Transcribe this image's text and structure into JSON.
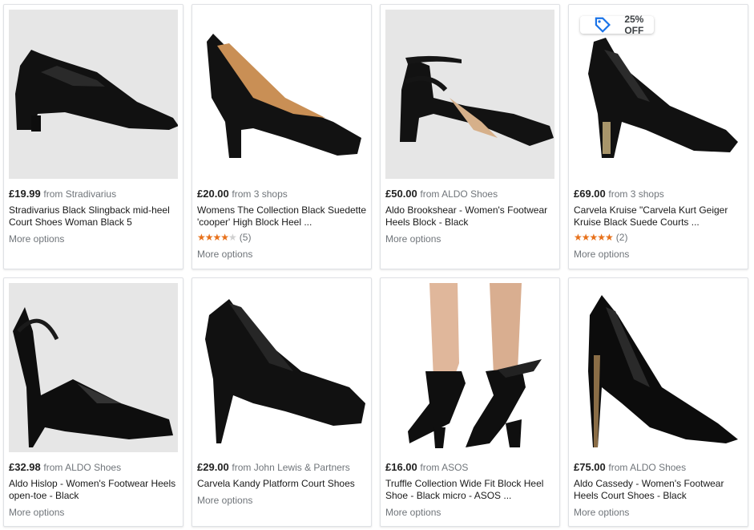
{
  "products": [
    {
      "price": "£19.99",
      "from": "from Stradivarius",
      "title": "Stradivarius Black Slingback mid-heel Court Shoes Woman Black 5",
      "more": "More options",
      "shoe_icon": "slingback-block-heel-image"
    },
    {
      "price": "£20.00",
      "from": "from 3 shops",
      "title": "Womens The Collection Black Suedette 'cooper' High Block Heel ...",
      "rating": {
        "stars": 4,
        "count": "(5)"
      },
      "more": "More options",
      "shoe_icon": "block-heel-court-image"
    },
    {
      "price": "£50.00",
      "from": "from ALDO Shoes",
      "title": "Aldo Brookshear - Women's Footwear Heels Block - Black",
      "more": "More options",
      "shoe_icon": "ankle-strap-block-heel-image"
    },
    {
      "price": "£69.00",
      "from": "from 3 shops",
      "title": "Carvela Kruise \"Carvela Kurt Geiger Kruise Black Suede Courts ...",
      "rating": {
        "stars": 5,
        "count": "(2)"
      },
      "more": "More options",
      "badge": "25% OFF",
      "shoe_icon": "gold-trim-block-heel-image"
    },
    {
      "price": "£32.98",
      "from": "from ALDO Shoes",
      "title": "Aldo Hislop - Women's Footwear Heels open-toe - Black",
      "more": "More options",
      "shoe_icon": "patent-platform-peeptoe-image"
    },
    {
      "price": "£29.00",
      "from": "from John Lewis & Partners",
      "title": "Carvela Kandy Platform Court Shoes",
      "more": "More options",
      "shoe_icon": "platform-stiletto-court-image"
    },
    {
      "price": "£16.00",
      "from": "from ASOS",
      "title": "Truffle Collection Wide Fit Block Heel Shoe - Black micro - ASOS ...",
      "more": "More options",
      "shoe_icon": "ankle-tie-block-heel-image"
    },
    {
      "price": "£75.00",
      "from": "from ALDO Shoes",
      "title": "Aldo Cassedy - Women's Footwear Heels Court Shoes - Black",
      "more": "More options",
      "shoe_icon": "stiletto-court-image"
    }
  ],
  "colors": {
    "star": "#e7711b",
    "star_off": "#d0d0d0",
    "muted": "#70757a",
    "tag_icon": "#1a73e8"
  }
}
